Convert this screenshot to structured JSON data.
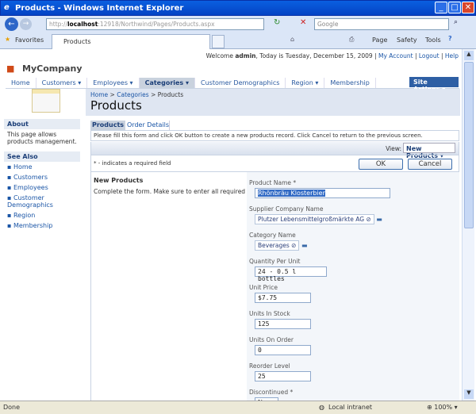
{
  "window": {
    "title": "Products - Windows Internet Explorer"
  },
  "browser": {
    "url_prefix": "http://",
    "url_host": "localhost",
    "url_rest": ":12918/Northwind/Pages/Products.aspx",
    "search_placeholder": "Google",
    "favorites_label": "Favorites",
    "tab_label": "Products",
    "page_menu": "Page",
    "safety_menu": "Safety",
    "tools_menu": "Tools"
  },
  "header": {
    "welcome": "Welcome ",
    "user": "admin",
    "date_text": ", Today is Tuesday, December 15, 2009",
    "my_account": "My Account",
    "logout": "Logout",
    "help": "Help",
    "sep": "|",
    "logo": "MyCompany"
  },
  "nav": {
    "items": [
      "Home",
      "Customers",
      "Employees",
      "Categories",
      "Customer Demographics",
      "Region",
      "Membership"
    ],
    "site_actions": "Site Actions"
  },
  "sidebar": {
    "about_title": "About",
    "about_text": "This page allows products management.",
    "see_also_title": "See Also",
    "links": [
      "Home",
      "Customers",
      "Employees",
      "Customer Demographics",
      "Region",
      "Membership"
    ]
  },
  "breadcrumb": {
    "items": [
      "Home",
      "Categories",
      "Products"
    ],
    "sep": ">"
  },
  "page_title": "Products",
  "tabs": [
    "Products",
    "Order Details"
  ],
  "description": "Please fill this form and click OK button to create a new products record. Click Cancel to return to the previous screen.",
  "view": {
    "label": "View:",
    "value": "New Products"
  },
  "required_note": "* - indicates a required field",
  "buttons": {
    "ok": "OK",
    "cancel": "Cancel"
  },
  "form": {
    "section_title": "New Products",
    "section_desc": "Complete the form. Make sure to enter all required fields.",
    "product_name": {
      "label": "Product Name *",
      "value": "Rhönbräu Klosterbier"
    },
    "supplier": {
      "label": "Supplier Company Name",
      "value": "Plutzer Lebensmittelgroßmärkte AG"
    },
    "category": {
      "label": "Category Name",
      "value": "Beverages"
    },
    "quantity": {
      "label": "Quantity Per Unit",
      "value": "24 - 0.5 l bottles"
    },
    "unit_price": {
      "label": "Unit Price",
      "value": "$7.75"
    },
    "units_in_stock": {
      "label": "Units In Stock",
      "value": "125"
    },
    "units_on_order": {
      "label": "Units On Order",
      "value": "0"
    },
    "reorder_level": {
      "label": "Reorder Level",
      "value": "25"
    },
    "discontinued": {
      "label": "Discontinued *",
      "value": "No"
    }
  },
  "status": {
    "left": "Done",
    "zone": "Local intranet",
    "zoom": "100%"
  }
}
